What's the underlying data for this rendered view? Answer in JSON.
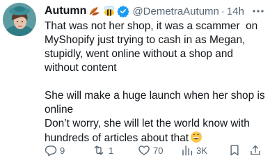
{
  "author": {
    "name": "Autumn",
    "handle": "@DemetraAutumn",
    "time": "14h",
    "badge_emojis": [
      "leaves-emoji",
      "bee-emoji"
    ],
    "verified": true
  },
  "tweet": {
    "paragraphs": [
      "That was not her shop, it was a scammer  on MyShopify just trying to cash in as Megan, stupidly, went online without a shop and without content",
      "She will make a huge launch when her shop is online",
      "Don’t worry, she will let the world know with hundreds of articles about that"
    ],
    "trailing_emoji": "grinning-sweat-emoji"
  },
  "actions": {
    "replies": "9",
    "reposts": "1",
    "likes": "70",
    "views": "3K"
  },
  "colors": {
    "text": "#0f1419",
    "secondary": "#536471",
    "verified": "#1d9bf0"
  }
}
